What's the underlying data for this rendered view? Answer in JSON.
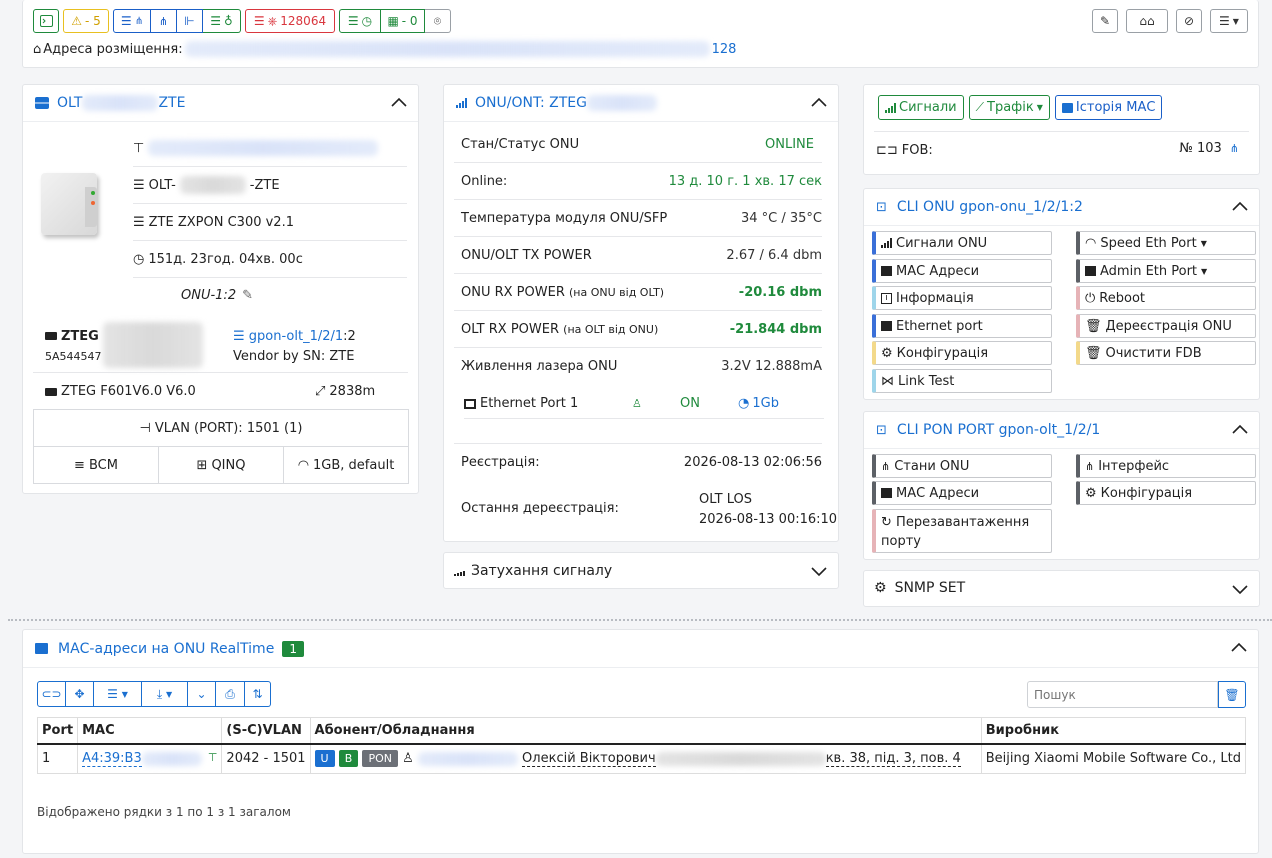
{
  "topbar": {
    "console_icon": "terminal-icon",
    "warnings": "- 5",
    "counter_red": "128064",
    "counter_green": "- 0",
    "address_label": "Адреса розміщення:",
    "address_suffix": "128"
  },
  "olt_card": {
    "title_prefix": "OLT",
    "title_suffix": "ZTE",
    "name_prefix": "OLT-",
    "name_suffix": "-ZTE",
    "model": "ZTE ZXPON C300 v2.1",
    "uptime": "151д. 23год. 04хв. 00с",
    "onu_label": "ONU-1:2",
    "onu_name": "ZTEG",
    "onu_sn": "5A544547",
    "pon_link": "gpon-olt_1/2/1",
    "pon_suffix": ":2",
    "vendor": "Vendor by SN: ZTE",
    "device_model": "ZTEG F601V6.0 V6.0",
    "distance": "2838m",
    "vlan": "VLAN (PORT): 1501 (1)",
    "profile_bcm": "BCM",
    "profile_qinq": "QINQ",
    "profile_speed": "1GB, default"
  },
  "onu_card": {
    "title": "ONU/ONT: ZTEG",
    "rows": [
      {
        "label": "Стан/Статус ONU",
        "value": "ONLINE",
        "small": ""
      },
      {
        "label": "Online:",
        "value": "13 д. 10 г. 1 хв. 17 сек",
        "small": ""
      },
      {
        "label": "Температура модуля ONU/SFP",
        "value": "34 °C / 35°C",
        "small": ""
      },
      {
        "label": "ONU/OLT TX POWER",
        "value": "2.67 / 6.4 dbm",
        "small": ""
      },
      {
        "label": "ONU RX POWER",
        "value": "-20.16 dbm",
        "small": "(на ONU від OLT)"
      },
      {
        "label": "OLT RX POWER",
        "value": "-21.844 dbm",
        "small": "(на OLT від ONU)"
      },
      {
        "label": "Живлення лазера ONU",
        "value": "3.2V 12.888mA",
        "small": ""
      }
    ],
    "eth_port": "Ethernet Port 1",
    "eth_state": "ON",
    "eth_speed": "1Gb",
    "reg_label": "Реєстрація:",
    "reg_value": "2026-08-13 02:06:56",
    "dereg_label": "Остання дереєстрація:",
    "dereg_reason": "OLT LOS",
    "dereg_value": "2026-08-13 00:16:10"
  },
  "attenuation": {
    "title": "Затухання сигналу"
  },
  "right_top": {
    "btn_signals": "Сигнали",
    "btn_traffic": "Трафік",
    "btn_mac_history": "Історія МАС",
    "fob_label": "FOB:",
    "fob_value": "№ 103"
  },
  "cli_onu": {
    "title": "CLI ONU gpon-onu_1/2/1:2",
    "left": [
      "Сигнали ONU",
      "МАС Адреси",
      "Інформація",
      "Ethernet port",
      "Конфігурація",
      "Link Test"
    ],
    "right": [
      "Speed Eth Port",
      "Admin Eth Port",
      "Reboot",
      "Дереєстрація ONU",
      "Очистити FDB"
    ]
  },
  "cli_pon": {
    "title": "CLI PON PORT gpon-olt_1/2/1",
    "left": [
      "Стани ONU",
      "МАС Адреси",
      "Перезавантаження",
      "порту"
    ],
    "right": [
      "Інтерфейс",
      "Конфігурація"
    ]
  },
  "snmp": {
    "title": "SNMP SET"
  },
  "mac_table": {
    "title": "МАС-адреси на ONU RealTime",
    "count": "1",
    "search_placeholder": "Пошук",
    "headers": [
      "Port",
      "MAC",
      "(S-C)VLAN",
      "Абонент/Обладнання",
      "Виробник"
    ],
    "row": {
      "port": "1",
      "mac": "A4:39:B3",
      "vlan": "2042 - 1501",
      "badge_u": "U",
      "badge_b": "B",
      "badge_pon": "PON",
      "subscriber_name": "Олексій Вікторович",
      "subscriber_addr": "кв. 38, під. 3, пов. 4",
      "vendor": "Beijing Xiaomi Mobile Software Co., Ltd"
    },
    "footer": "Відображено рядки з 1 по 1 з 1 загалом"
  }
}
